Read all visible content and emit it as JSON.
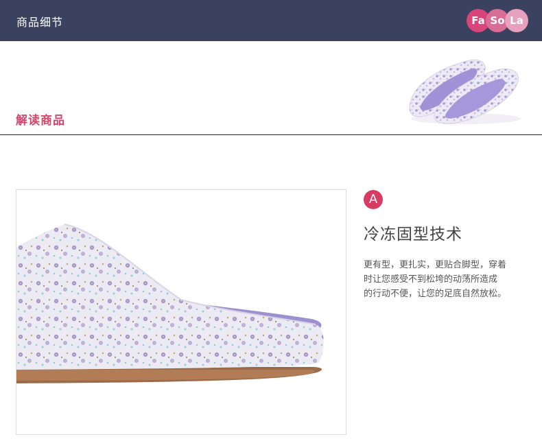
{
  "header": {
    "title": "商品细节",
    "logo": {
      "parts": [
        "Fa",
        "So",
        "La"
      ],
      "colors": [
        "#d9457a",
        "#d86d96",
        "#e7a0bd"
      ]
    },
    "background": "#3b4260"
  },
  "banner": {
    "label": "解读商品",
    "label_color": "#d3456a",
    "thumbnail_alt": "slipper-pair-thumbnail"
  },
  "feature": {
    "badge": "A",
    "badge_color": "#d73c63",
    "title": "冷冻固型技术",
    "desc_lines": [
      "更有型，更扎实，更贴合脚型，穿着",
      "时让您感受不到松垮的动荡所造成",
      "的行动不便，让您的足底自然放松。"
    ]
  }
}
